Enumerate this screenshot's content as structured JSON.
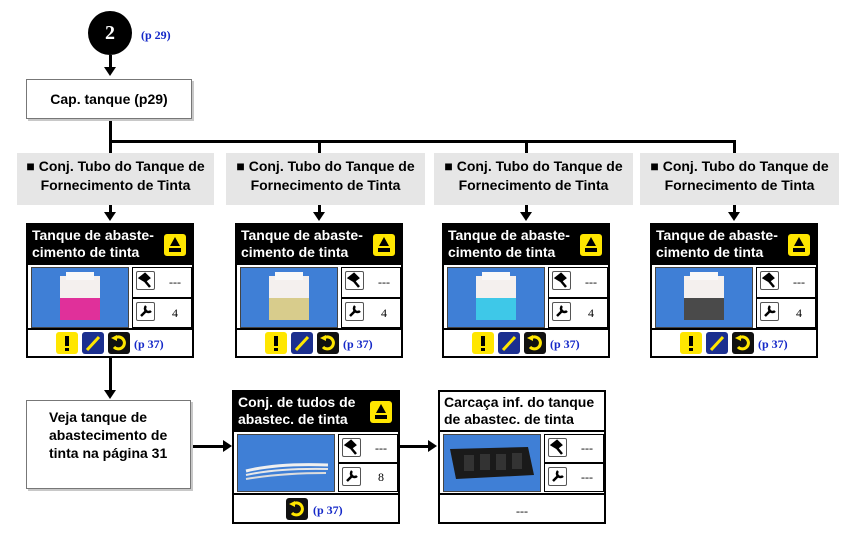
{
  "step": {
    "number": "2",
    "page_ref": "(p 29)"
  },
  "root": {
    "label": "Cap. tanque (p29)"
  },
  "groups": [
    {
      "label": "■ Conj. Tubo do Tanque de Fornecimento de Tinta",
      "card": {
        "title": "Tanque de abaste-cimento de tinta",
        "photo_color": "#e0309a",
        "screw_value": "---",
        "wrench_value": "4",
        "page_ref": "(p 37)"
      }
    },
    {
      "label": "■ Conj. Tubo do Tanque de Fornecimento de Tinta",
      "card": {
        "title": "Tanque de abaste-cimento de tinta",
        "photo_color": "#d8cc8c",
        "screw_value": "---",
        "wrench_value": "4",
        "page_ref": "(p 37)"
      }
    },
    {
      "label": "■ Conj. Tubo do Tanque de Fornecimento de Tinta",
      "card": {
        "title": "Tanque de abaste-cimento de tinta",
        "photo_color": "#3ec8e8",
        "screw_value": "---",
        "wrench_value": "4",
        "page_ref": "(p 37)"
      }
    },
    {
      "label": "■ Conj. Tubo do Tanque de Fornecimento de Tinta",
      "card": {
        "title": "Tanque de abaste-cimento de tinta",
        "photo_color": "#4a4a4a",
        "screw_value": "---",
        "wrench_value": "4",
        "page_ref": "(p 37)"
      }
    }
  ],
  "note": {
    "text": "Veja tanque de abastecimento de tinta na página 31"
  },
  "tubes_card": {
    "title": "Conj. de tudos de abastec. de tinta",
    "screw_value": "---",
    "wrench_value": "8",
    "page_ref": "(p 37)"
  },
  "housing_card": {
    "title": "Carcaça inf. do tanque de abastec. de tinta",
    "screw_value": "---",
    "wrench_value": "---",
    "footer": "---"
  },
  "colors": {
    "accent_yellow": "#ffe600",
    "photo_blue": "#3f7fd6",
    "ref_blue": "#1428c8",
    "label_gray": "#e6e6e6"
  }
}
